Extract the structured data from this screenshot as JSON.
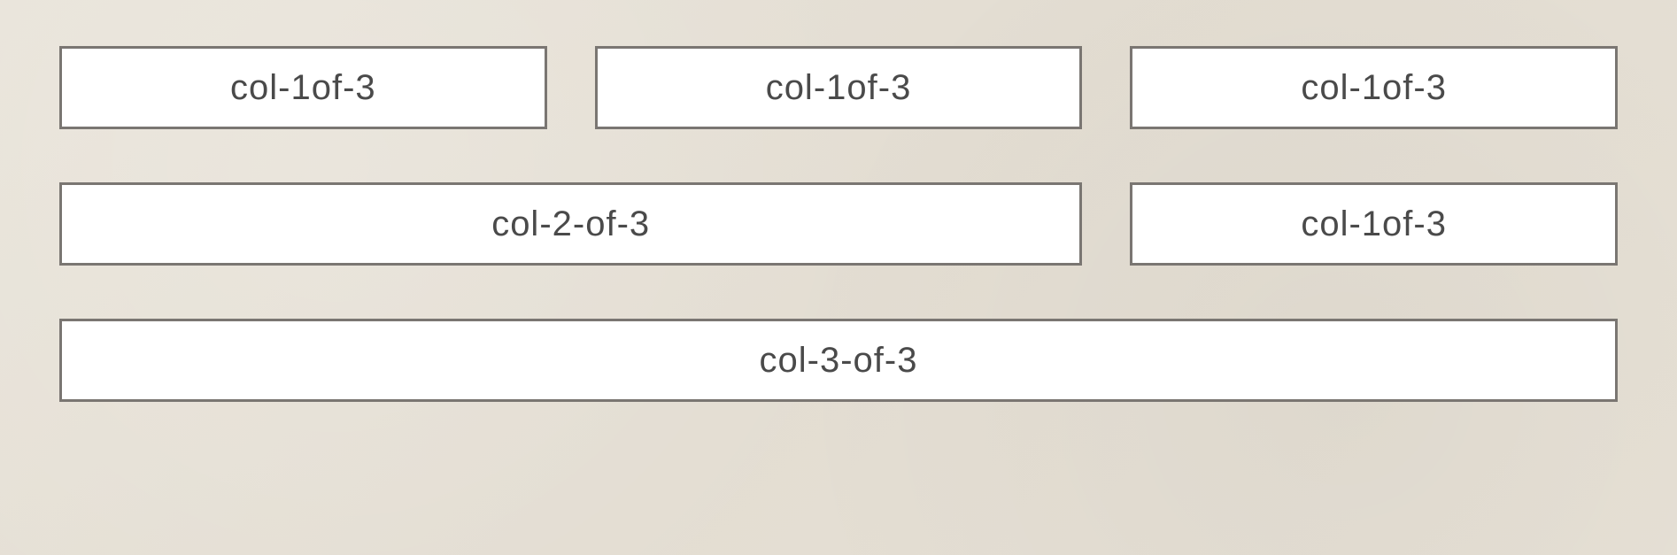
{
  "rows": [
    {
      "cells": [
        {
          "label": "col-1of-3",
          "span": 1
        },
        {
          "label": "col-1of-3",
          "span": 1
        },
        {
          "label": "col-1of-3",
          "span": 1
        }
      ]
    },
    {
      "cells": [
        {
          "label": "col-2-of-3",
          "span": 2
        },
        {
          "label": "col-1of-3",
          "span": 1
        }
      ]
    },
    {
      "cells": [
        {
          "label": "col-3-of-3",
          "span": 3
        }
      ]
    }
  ],
  "colors": {
    "background": "#e7e2d8",
    "cell_bg": "#ffffff",
    "cell_border": "#7a7672",
    "text": "#4a4a4a"
  }
}
